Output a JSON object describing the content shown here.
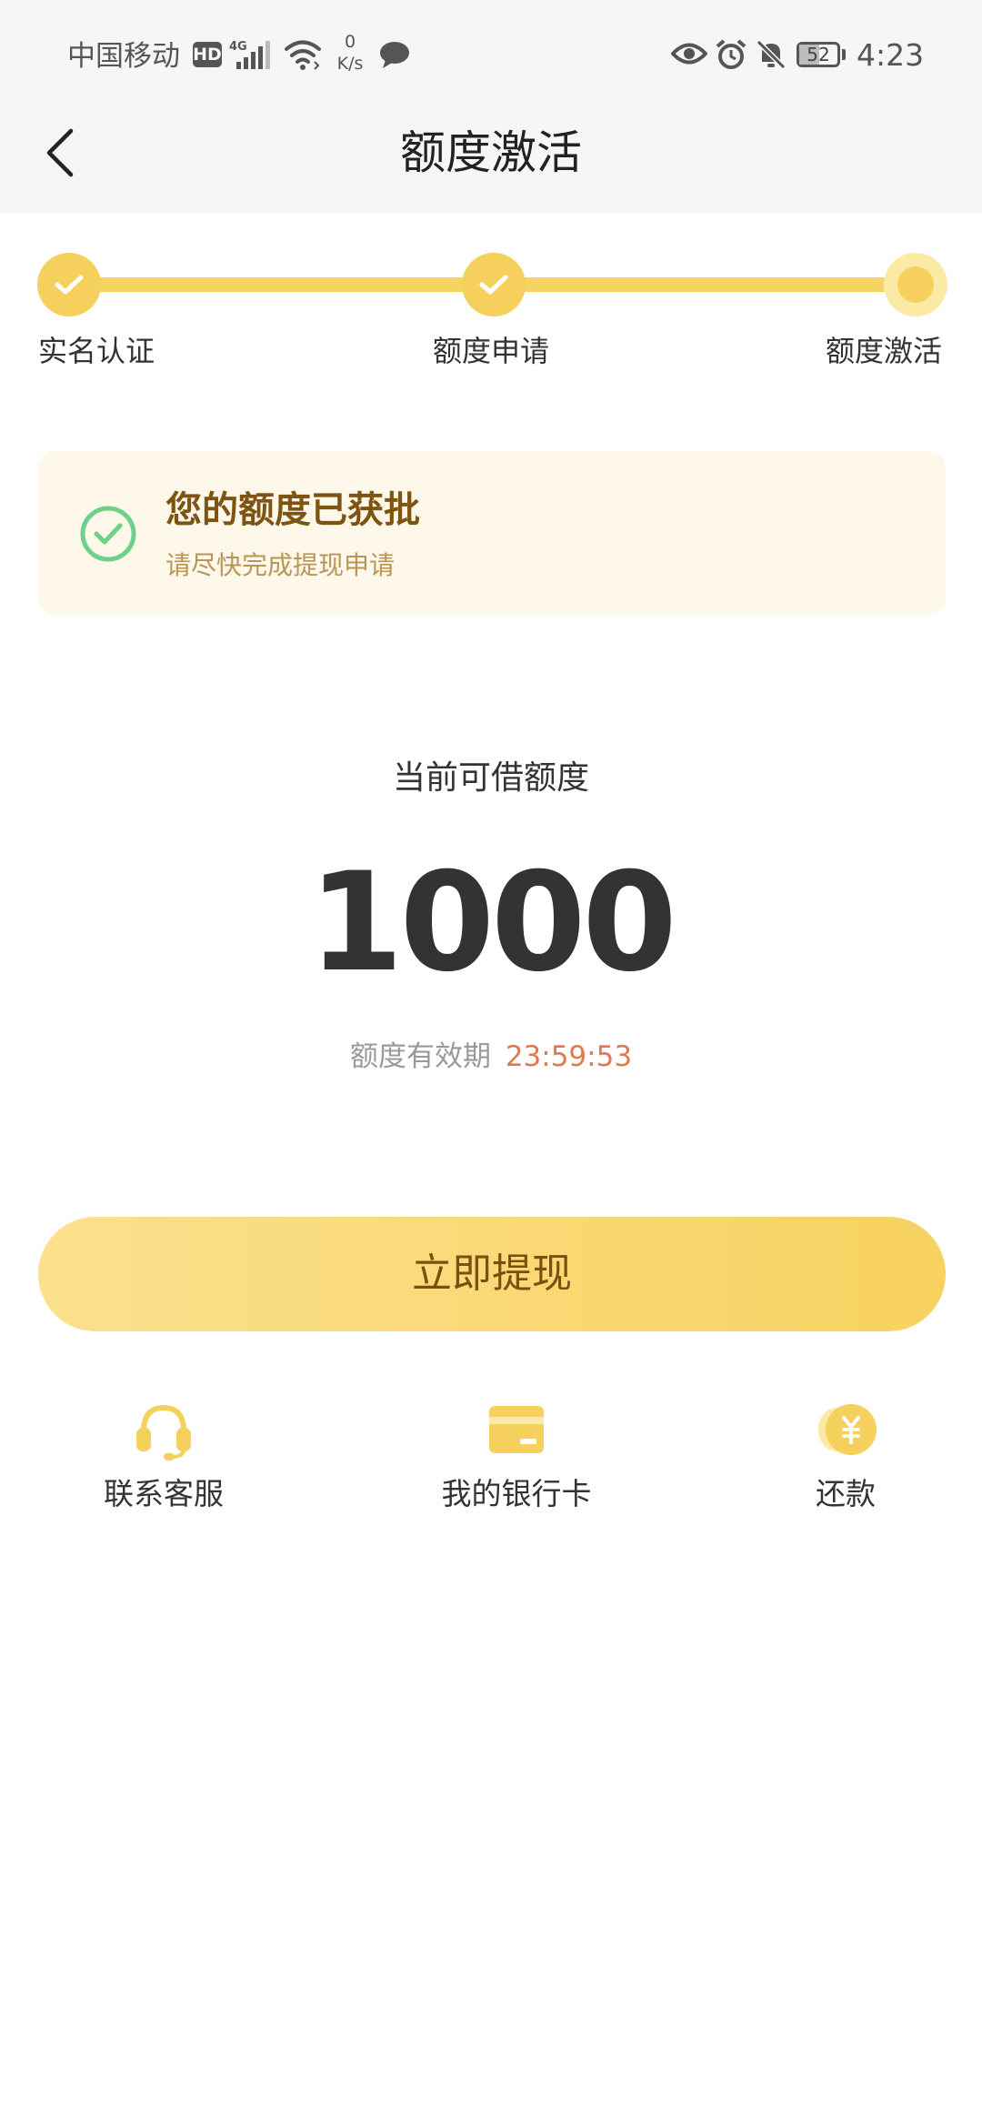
{
  "status_bar": {
    "carrier": "中国移动",
    "hd_badge": "HD",
    "network": "4G",
    "speed_value": "0",
    "speed_unit": "K/s",
    "battery": "52",
    "time": "4:23"
  },
  "header": {
    "title": "额度激活"
  },
  "stepper": {
    "steps": [
      {
        "label": "实名认证",
        "state": "done"
      },
      {
        "label": "额度申请",
        "state": "done"
      },
      {
        "label": "额度激活",
        "state": "current"
      }
    ]
  },
  "notice": {
    "title": "您的额度已获批",
    "subtitle": "请尽快完成提现申请"
  },
  "amount": {
    "label": "当前可借额度",
    "value": "1000",
    "validity_label": "额度有效期",
    "validity_time": "23:59:53"
  },
  "cta": {
    "label": "立即提现"
  },
  "actions": [
    {
      "label": "联系客服",
      "icon": "headset-icon"
    },
    {
      "label": "我的银行卡",
      "icon": "bank-card-icon"
    },
    {
      "label": "还款",
      "icon": "yuan-coin-icon"
    }
  ],
  "colors": {
    "accent": "#f6d05c",
    "notice_title": "#7d5412",
    "countdown": "#e0794e",
    "success_check": "#6fd08c"
  }
}
